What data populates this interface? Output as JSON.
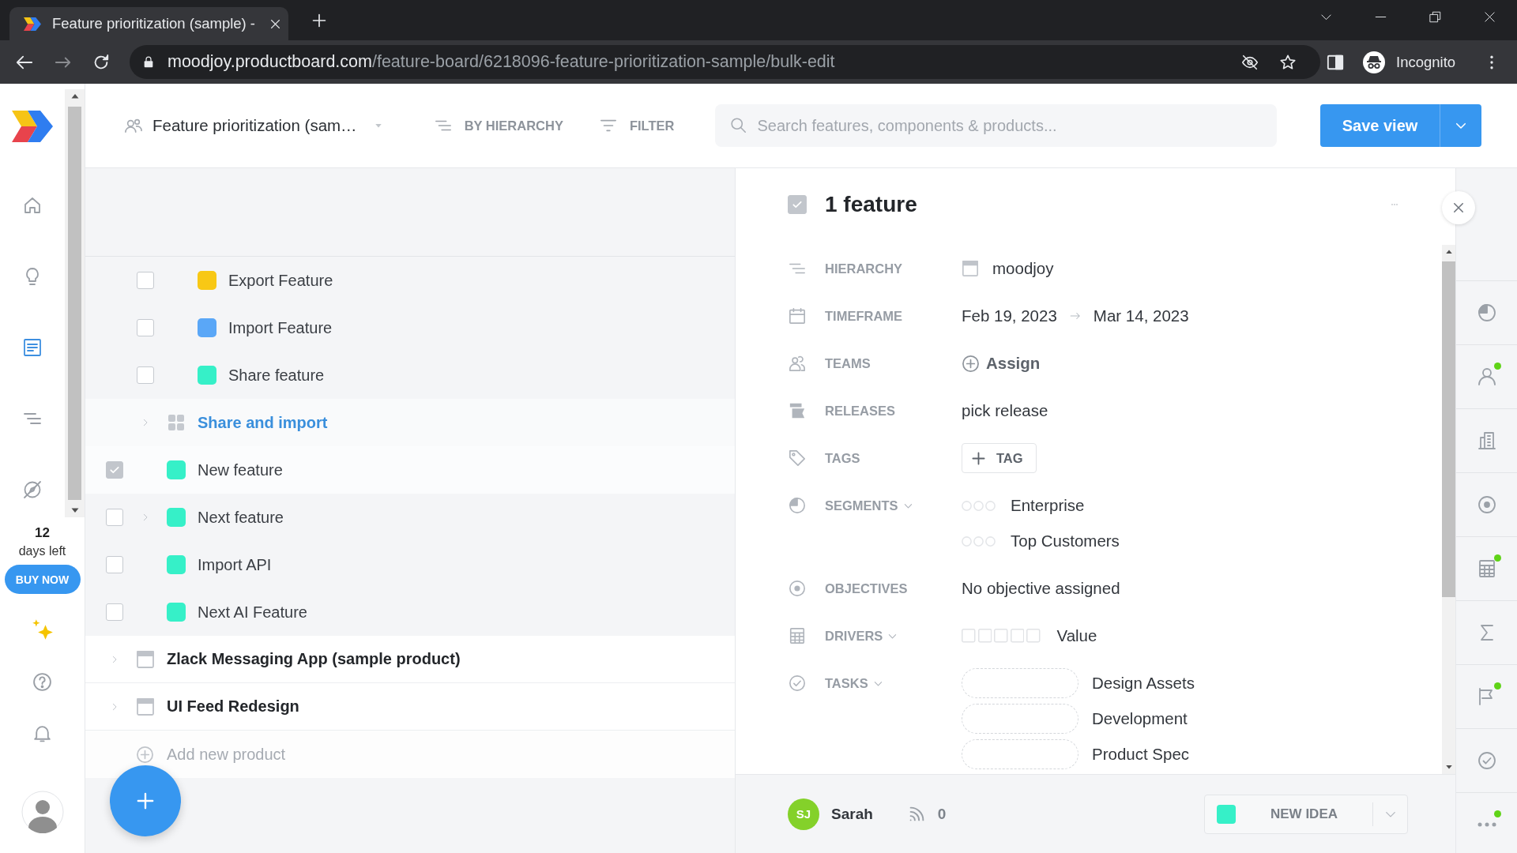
{
  "browser": {
    "tab": {
      "title": "Feature prioritization (sample) -"
    },
    "address": {
      "host": "moodjoy.productboard.com",
      "path": "/feature-board/6218096-feature-prioritization-sample/bulk-edit"
    },
    "profile": "Incognito"
  },
  "sidebar": {
    "nav_items": [
      {
        "selected": false
      },
      {
        "selected": false
      },
      {
        "selected": true
      },
      {
        "selected": false
      },
      {
        "selected": false
      }
    ],
    "trial": {
      "days": "12",
      "caption": "days left",
      "button": "BUY NOW"
    }
  },
  "toolbar": {
    "board": "Feature prioritization (sam…",
    "controls": [
      "BY HIERARCHY",
      "FILTER"
    ],
    "search": {
      "placeholder": "Search features, components & products..."
    },
    "save_button": "Save view"
  },
  "tree": {
    "rows": [
      {
        "kind": "subfeature",
        "label": "Export Feature",
        "color": "#f8c815",
        "checked": false,
        "expandable": false
      },
      {
        "kind": "subfeature",
        "label": "Import Feature",
        "color": "#5aa7f7",
        "checked": false,
        "expandable": false
      },
      {
        "kind": "subfeature",
        "label": "Share feature",
        "color": "#36f0c8",
        "checked": false,
        "expandable": false
      },
      {
        "kind": "component",
        "label": "Share and import",
        "expandable": true
      },
      {
        "kind": "feature",
        "label": "New feature",
        "color": "#36f0c8",
        "checked": true,
        "expandable": false
      },
      {
        "kind": "feature",
        "label": "Next feature",
        "color": "#36f0c8",
        "checked": false,
        "expandable": true
      },
      {
        "kind": "feature",
        "label": "Import API",
        "color": "#36f0c8",
        "checked": false,
        "expandable": false
      },
      {
        "kind": "feature",
        "label": "Next AI Feature",
        "color": "#36f0c8",
        "checked": false,
        "expandable": false
      },
      {
        "kind": "product",
        "label": "Zlack Messaging App (sample product)",
        "expandable": true
      },
      {
        "kind": "product",
        "label": "UI Feed Redesign",
        "expandable": true
      }
    ],
    "add_product": "Add new product"
  },
  "detail": {
    "checked": true,
    "title": "1 feature",
    "fields": [
      {
        "kind": "hierarchy",
        "label": "HIERARCHY",
        "dropdown": false,
        "value": "moodjoy"
      },
      {
        "kind": "timeframe",
        "label": "TIMEFRAME",
        "dropdown": false,
        "start": "Feb 19, 2023",
        "end": "Mar 14, 2023"
      },
      {
        "kind": "assign",
        "label": "TEAMS",
        "dropdown": false,
        "action": "Assign"
      },
      {
        "kind": "text",
        "label": "RELEASES",
        "dropdown": false,
        "value": "pick release"
      },
      {
        "kind": "tag",
        "label": "TAGS",
        "dropdown": false,
        "action": "TAG"
      },
      {
        "kind": "segments",
        "label": "SEGMENTS",
        "dropdown": true,
        "items": [
          "Enterprise",
          "Top Customers"
        ]
      },
      {
        "kind": "text",
        "label": "OBJECTIVES",
        "dropdown": false,
        "value": "No objective assigned"
      },
      {
        "kind": "drivers",
        "label": "DRIVERS",
        "dropdown": true,
        "items": [
          "Value"
        ]
      },
      {
        "kind": "tasks",
        "label": "TASKS",
        "dropdown": true,
        "items": [
          "Design Assets",
          "Development",
          "Product Spec"
        ]
      }
    ],
    "footer": {
      "owner": {
        "initials": "SJ",
        "name": "Sarah"
      },
      "followers": "0",
      "status": {
        "label": "NEW IDEA",
        "color": "#36f0c8"
      }
    }
  },
  "rail": [
    {
      "dot": false
    },
    {
      "dot": true
    },
    {
      "dot": false
    },
    {
      "dot": false
    },
    {
      "dot": true
    },
    {
      "dot": false
    },
    {
      "dot": true
    },
    {
      "dot": false
    },
    {
      "dot": true
    }
  ]
}
